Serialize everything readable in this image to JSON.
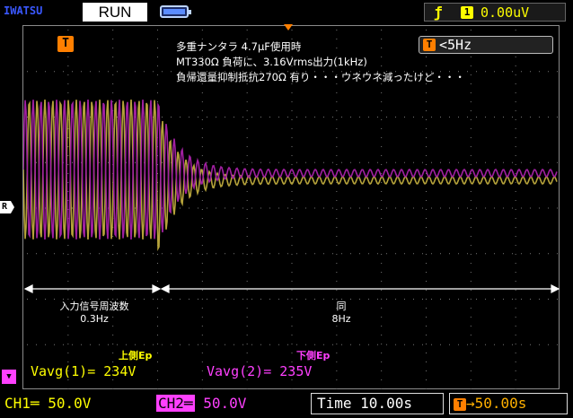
{
  "header": {
    "brand": "IWATSU",
    "run_state": "RUN",
    "trigger": {
      "edge_icon": "rising-edge-icon",
      "source": "1",
      "level": "0.00uV"
    }
  },
  "screen": {
    "trigger_pos_flag": "T",
    "freq_flag": "T",
    "freq_readout": "<5Hz",
    "notes": [
      "多重ナンタラ 4.7μF使用時",
      "MT330Ω 負荷に、3.16Vrms出力(1kHz)",
      "負帰還量抑制抵抗270Ω 有り・・・ウネウネ減ったけど・・・"
    ],
    "ref_marker": "R",
    "segments": [
      {
        "label": "入力信号周波数",
        "value": "0.3Hz"
      },
      {
        "label": "同",
        "value": "8Hz"
      }
    ],
    "measurements": [
      {
        "title": "上側Ep",
        "label": "Vavg(1)=",
        "value": "234V",
        "color": "#ffff00"
      },
      {
        "title": "下側Ep",
        "label": "Vavg(2)=",
        "value": "235V",
        "color": "#ff40ff"
      }
    ]
  },
  "footer": {
    "ch1": {
      "name": "CH1",
      "coupling": "═",
      "scale": "50.0V"
    },
    "ch2": {
      "name": "CH2",
      "coupling": "═",
      "scale": "50.0V"
    },
    "time_label": "Time",
    "time_value": "10.00s",
    "offset_flag": "T",
    "offset_value": "→50.00s"
  },
  "colors": {
    "ch1": "#b5a23a",
    "ch2": "#a020a0",
    "grid": "#8a8a8a"
  }
}
